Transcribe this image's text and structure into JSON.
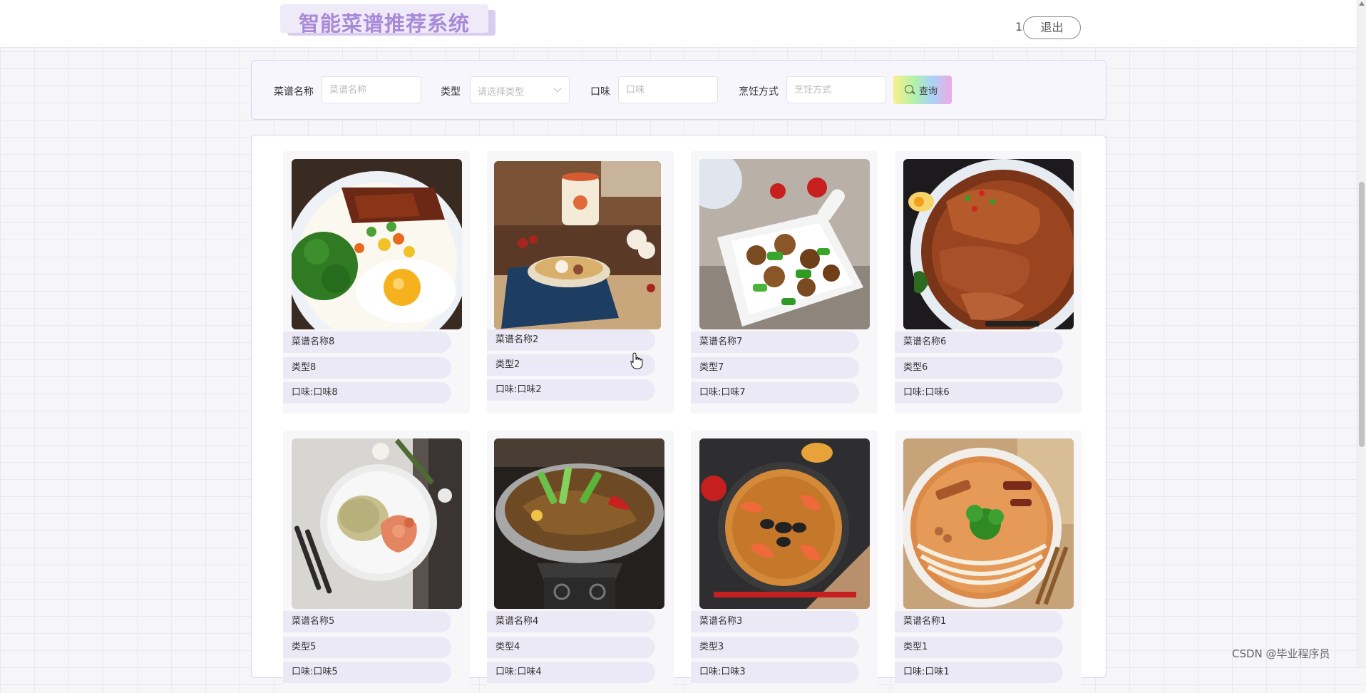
{
  "header": {
    "title": "智能菜谱推荐系统",
    "user_number": "1",
    "logout_label": "退出"
  },
  "search": {
    "name_label": "菜谱名称",
    "name_placeholder": "菜谱名称",
    "type_label": "类型",
    "type_placeholder": "请选择类型",
    "taste_label": "口味",
    "taste_placeholder": "口味",
    "method_label": "烹饪方式",
    "method_placeholder": "烹饪方式",
    "query_label": "查询"
  },
  "recipes": [
    {
      "name": "菜谱名称8",
      "type": "类型8",
      "taste": "口味:口味8",
      "image": "rice-bowl-braised-pork-egg-broccoli"
    },
    {
      "name": "菜谱名称2",
      "type": "类型2",
      "taste": "口味:口味2",
      "image": "soup-bowl-table-setting"
    },
    {
      "name": "菜谱名称7",
      "type": "类型7",
      "taste": "口味:口味7",
      "image": "chicken-green-pepper-stir-fry"
    },
    {
      "name": "菜谱名称6",
      "type": "类型6",
      "taste": "口味:口味6",
      "image": "braised-duck-noodle-bowl"
    },
    {
      "name": "菜谱名称5",
      "type": "类型5",
      "taste": "口味:口味5",
      "image": "shrimp-rice-plate"
    },
    {
      "name": "菜谱名称4",
      "type": "类型4",
      "taste": "口味:口味4",
      "image": "dry-pot-fish"
    },
    {
      "name": "菜谱名称3",
      "type": "类型3",
      "taste": "口味:口味3",
      "image": "seafood-paella-pan"
    },
    {
      "name": "菜谱名称1",
      "type": "类型1",
      "taste": "口味:口味1",
      "image": "rice-noodle-soup"
    }
  ],
  "watermark": "CSDN @毕业程序员",
  "colors": {
    "title_purple": "#a98ad8",
    "pill_bg": "#ece9f6",
    "panel_border": "#d9d3f2"
  }
}
